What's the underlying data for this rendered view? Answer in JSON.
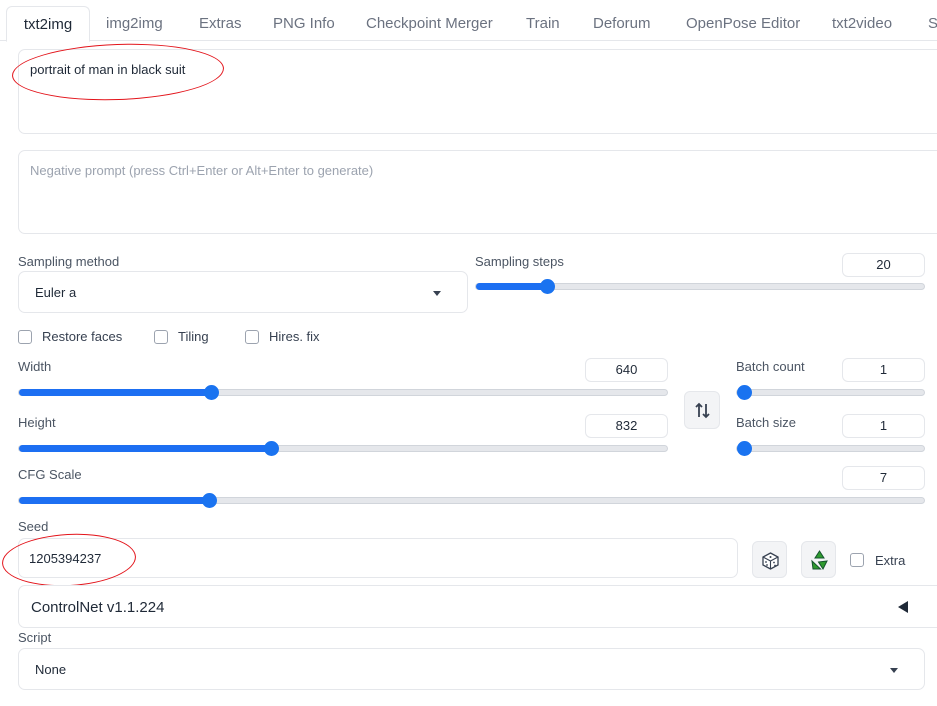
{
  "tabs": [
    "txt2img",
    "img2img",
    "Extras",
    "PNG Info",
    "Checkpoint Merger",
    "Train",
    "Deforum",
    "OpenPose Editor",
    "txt2video",
    "S"
  ],
  "prompt": {
    "value": "portrait of man in black suit"
  },
  "negative_prompt": {
    "placeholder": "Negative prompt (press Ctrl+Enter or Alt+Enter to generate)"
  },
  "sampling": {
    "method_label": "Sampling method",
    "method_value": "Euler a",
    "steps_label": "Sampling steps",
    "steps_value": "20",
    "steps_fraction": 0.158
  },
  "options": {
    "restore_faces": "Restore faces",
    "tiling": "Tiling",
    "hires_fix": "Hires. fix"
  },
  "width": {
    "label": "Width",
    "value": "640",
    "fraction": 0.296
  },
  "height": {
    "label": "Height",
    "value": "832",
    "fraction": 0.389
  },
  "swap_icon": "swap-arrows-icon",
  "batch_count": {
    "label": "Batch count",
    "value": "1",
    "fraction": 0
  },
  "batch_size": {
    "label": "Batch size",
    "value": "1",
    "fraction": 0
  },
  "cfg": {
    "label": "CFG Scale",
    "value": "7",
    "fraction": 0.21
  },
  "seed": {
    "label": "Seed",
    "value": "1205394237",
    "extra_label": "Extra",
    "dice_icon": "dice-icon",
    "recycle_icon": "recycle-icon"
  },
  "controlnet": {
    "title": "ControlNet v1.1.224"
  },
  "script": {
    "label": "Script",
    "value": "None"
  },
  "colors": {
    "accent": "#1a73f0",
    "annotation": "#e3141b",
    "recycle": "#2e9b2e"
  }
}
